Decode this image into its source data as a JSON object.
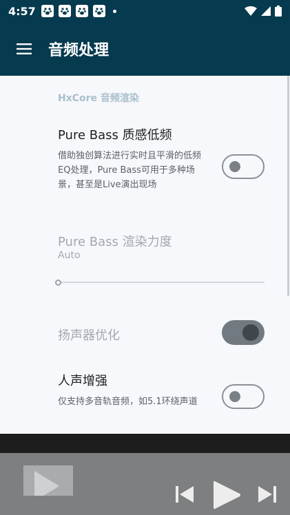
{
  "status_bar": {
    "time": "4:57"
  },
  "app_bar": {
    "title": "音频处理"
  },
  "section": {
    "title": "HxCore 音频渲染"
  },
  "prefs": {
    "pure_bass": {
      "title": "Pure Bass 质感低频",
      "summary": "借助独创算法进行实时且平滑的低频EQ处理，Pure Bass可用于多种场景，甚至是Live演出现场",
      "enabled": false
    },
    "pure_bass_strength": {
      "title": "Pure Bass 渲染力度",
      "summary": "Auto",
      "level": 0
    },
    "speaker_opt": {
      "title": "扬声器优化",
      "enabled": true
    },
    "vocal_enhance": {
      "title": "人声增强",
      "summary": "仅支持多音轨音频，如5.1环绕声道",
      "enabled": false
    }
  },
  "colors": {
    "primary": "#063a4e",
    "background": "#f6f8fb"
  }
}
